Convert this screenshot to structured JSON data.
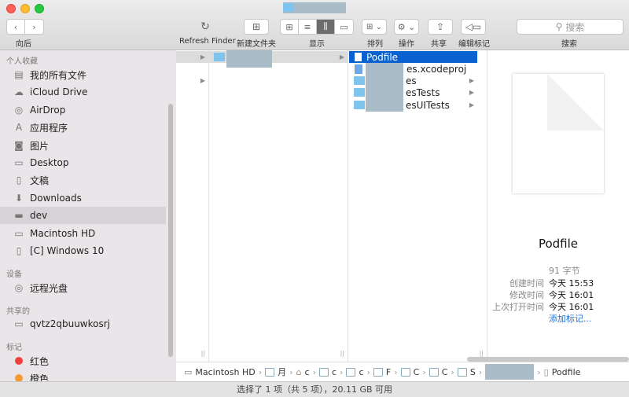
{
  "toolbar": {
    "back_label": "向后",
    "refresh_label": "Refresh Finder",
    "new_folder_label": "新建文件夹",
    "view_label": "显示",
    "arrange_label": "排列",
    "action_label": "操作",
    "share_label": "共享",
    "tags_label": "编辑标记",
    "search_label": "搜索",
    "search_placeholder": "搜索"
  },
  "sidebar": {
    "favorites_header": "个人收藏",
    "favorites": [
      {
        "label": "我的所有文件",
        "icon": "all-files-icon"
      },
      {
        "label": "iCloud Drive",
        "icon": "cloud-icon"
      },
      {
        "label": "AirDrop",
        "icon": "airdrop-icon"
      },
      {
        "label": "应用程序",
        "icon": "applications-icon"
      },
      {
        "label": "图片",
        "icon": "camera-icon"
      },
      {
        "label": "Desktop",
        "icon": "desktop-icon"
      },
      {
        "label": "文稿",
        "icon": "document-icon"
      },
      {
        "label": "Downloads",
        "icon": "download-icon"
      },
      {
        "label": "dev",
        "icon": "folder-icon",
        "active": true
      },
      {
        "label": "Macintosh HD",
        "icon": "hard-drive-icon"
      },
      {
        "label": "[C] Windows 10",
        "icon": "hard-drive-icon"
      }
    ],
    "devices_header": "设备",
    "devices": [
      {
        "label": "远程光盘",
        "icon": "disc-icon"
      }
    ],
    "shared_header": "共享的",
    "shared": [
      {
        "label": "qvtz2qbuuwkosrj",
        "icon": "computer-icon"
      }
    ],
    "tags_header": "标记",
    "tags": [
      {
        "label": "红色",
        "color": "#f0413e"
      },
      {
        "label": "橙色",
        "color": "#f79a32"
      }
    ]
  },
  "columns": {
    "col3": {
      "items": [
        {
          "label": "Podfile",
          "selected": true
        },
        {
          "label": "es.xcodeproj"
        },
        {
          "label": "es"
        },
        {
          "label": "esTests"
        },
        {
          "label": "esUITests"
        }
      ]
    }
  },
  "preview": {
    "name": "Podfile",
    "size": "91 字节",
    "created_label": "创建时间",
    "created_value": "今天 15:53",
    "modified_label": "修改时间",
    "modified_value": "今天 16:01",
    "opened_label": "上次打开时间",
    "opened_value": "今天 16:01",
    "add_tags": "添加标记..."
  },
  "pathbar": {
    "segments": [
      "Macintosh HD",
      "月",
      "c",
      "c",
      "c",
      "F",
      "C",
      "C",
      "S"
    ],
    "last": "Podfile"
  },
  "status": {
    "text": "选择了 1 项（共 5 项），20.11 GB 可用"
  }
}
